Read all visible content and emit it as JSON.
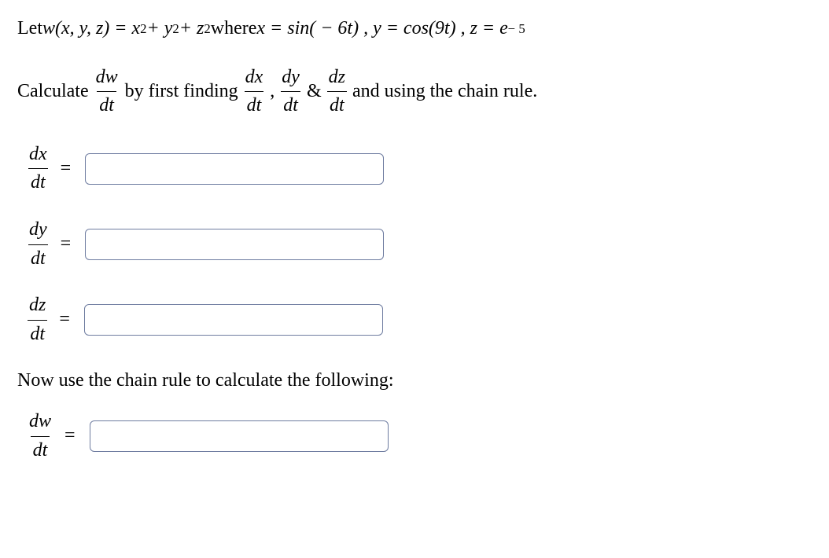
{
  "problem": {
    "let": "Let ",
    "w_func": "w(x, y, z) = x",
    "sq1": "2",
    "plus_y": " + y",
    "sq2": "2",
    "plus_z": " + z",
    "sq3": "2",
    "where": " where ",
    "x_eq": "x = sin( − 6t) , y = cos(9t) , z = e",
    "exp_neg5": "− 5"
  },
  "instruction": {
    "calc": "Calculate ",
    "dw": "dw",
    "dt": "dt",
    "by_first": " by first finding ",
    "dx": "dx",
    "comma": ", ",
    "dy": "dy",
    "amp": " & ",
    "dz": "dz",
    "and_using": " and using the chain rule."
  },
  "fields": {
    "dx_num": "dx",
    "dx_den": "dt",
    "dy_num": "dy",
    "dy_den": "dt",
    "dz_num": "dz",
    "dz_den": "dt",
    "dw_num": "dw",
    "dw_den": "dt",
    "eq": "="
  },
  "chain_rule_text": "Now use the chain rule to calculate the following:"
}
